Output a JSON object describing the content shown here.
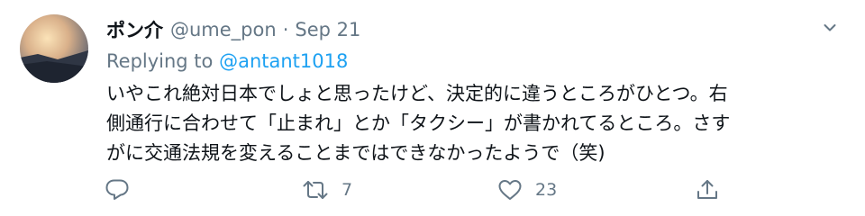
{
  "tweet": {
    "display_name": "ポン介",
    "handle": "@ume_pon",
    "separator": "·",
    "date": "Sep 21",
    "replying_to_label": "Replying to",
    "replying_to_mention": "@antant1018",
    "text_lines": [
      "いやこれ絶対日本でしょと思ったけど、決定的に違うところがひとつ。右",
      "側通行に合わせて「止まれ」とか「タクシー」が書かれてるところ。さす",
      "がに交通法規を変えることまではできなかったようで（笑)"
    ]
  },
  "actions": {
    "reply_icon": "reply-icon",
    "retweet_icon": "retweet-icon",
    "retweet_count": "7",
    "like_icon": "heart-icon",
    "like_count": "23",
    "share_icon": "share-icon"
  },
  "colors": {
    "text": "#0f1419",
    "secondary": "#657786",
    "link": "#1da1f2"
  }
}
